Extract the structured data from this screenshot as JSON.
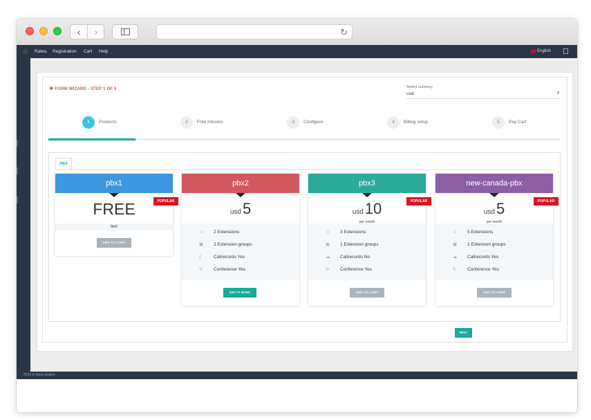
{
  "nav": {
    "links": [
      "Rates",
      "Registration",
      "Cart",
      "Help"
    ],
    "language": "English"
  },
  "wizard": {
    "title": "FORM WIZARD - STEP 1 OF 6",
    "currency_label": "Select currency",
    "currency_value": "usd"
  },
  "steps": [
    {
      "number": "1",
      "label": "Products",
      "active": true
    },
    {
      "number": "2",
      "label": "Free minutes"
    },
    {
      "number": "3",
      "label": "Configure"
    },
    {
      "number": "4",
      "label": "Billing setup"
    },
    {
      "number": "5",
      "label": "Pay Cart"
    }
  ],
  "tab": {
    "label": "PBX"
  },
  "cards": [
    {
      "name": "pbx1",
      "price": "FREE",
      "subtitle": "test",
      "button": "ADD TO CART",
      "popular_label": "POPULAR"
    },
    {
      "name": "pbx2",
      "currency": "usd",
      "price": "5",
      "features": [
        "2 Extensions",
        "2 Extension groups",
        "Callrecords Yes",
        "Conference Yes"
      ],
      "button": "GET IT NOW!"
    },
    {
      "name": "pbx3",
      "currency": "usd",
      "price": "10",
      "period": "per month",
      "features": [
        "3 Extensions",
        "1 Extension groups",
        "Callrecords No",
        "Conference Yes"
      ],
      "button": "ADD TO CART",
      "popular_label": "POPULAR"
    },
    {
      "name": "new-canada-pbx",
      "currency": "usd",
      "price": "5",
      "period": "per month",
      "features": [
        "5 Extensions",
        "1 Extension groups",
        "Callrecords Yes",
        "Conference Yes"
      ],
      "button": "ADD TO CART",
      "popular_label": "POPULAR"
    }
  ],
  "next_label": "NEXT",
  "footer": "2015 © Ooox.Switch",
  "colors": {
    "pbx1": "#3d97de",
    "pbx2": "#d0585e",
    "pbx3": "#2ba99a",
    "new-canada-pbx": "#8c5ea6",
    "accent": "#1aa99a",
    "popular": "#dd1122"
  }
}
